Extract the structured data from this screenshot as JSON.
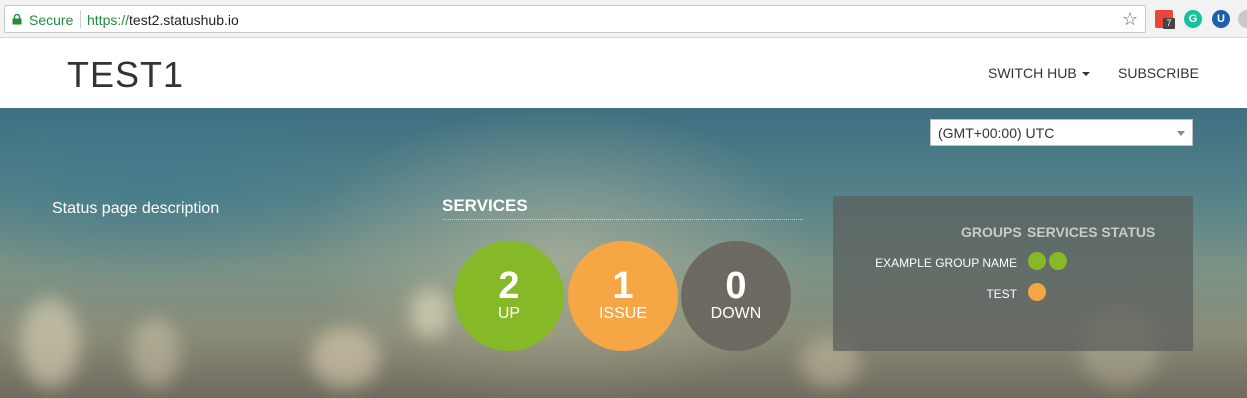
{
  "browser": {
    "secure_label": "Secure",
    "url_scheme": "https://",
    "url_host": "test2.statushub.io",
    "extensions": [
      {
        "name": "calendar-extension",
        "badge": "7"
      },
      {
        "name": "grammarly-extension",
        "glyph": "G"
      },
      {
        "name": "u-extension",
        "glyph": "U"
      },
      {
        "name": "grey-extension"
      }
    ]
  },
  "header": {
    "title": "TEST1",
    "nav": {
      "switch_hub": "SWITCH HUB",
      "subscribe": "SUBSCRIBE"
    }
  },
  "timezone": {
    "selected": "(GMT+00:00) UTC"
  },
  "description": "Status page description",
  "services": {
    "heading": "SERVICES",
    "counts": [
      {
        "value": "2",
        "label": "UP",
        "color": "#85b928"
      },
      {
        "value": "1",
        "label": "ISSUE",
        "color": "#f7a646"
      },
      {
        "value": "0",
        "label": "DOWN",
        "color": "#6c6a60"
      }
    ]
  },
  "groups": {
    "header_groups": "GROUPS",
    "header_status": "SERVICES STATUS",
    "rows": [
      {
        "name": "EXAMPLE GROUP NAME",
        "statuses": [
          "up",
          "up"
        ]
      },
      {
        "name": "TEST",
        "statuses": [
          "issue"
        ]
      }
    ]
  },
  "colors": {
    "up": "#85b928",
    "issue": "#f7a646",
    "down": "#6c6a60",
    "secure": "#1e8e3e"
  }
}
